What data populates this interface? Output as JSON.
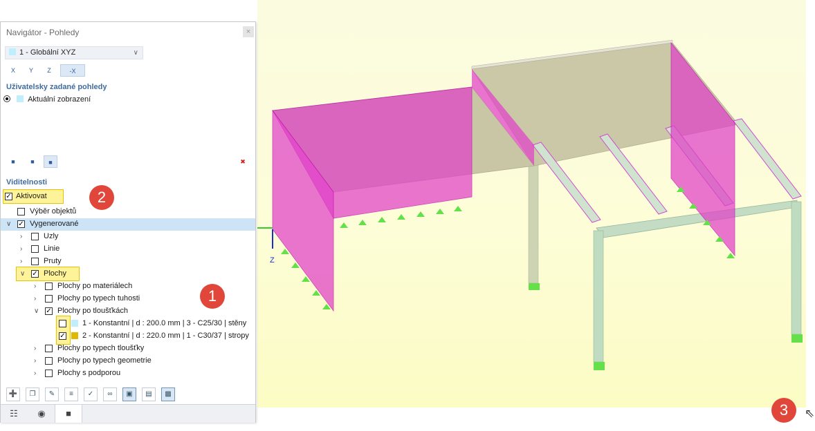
{
  "navigator": {
    "title": "Navigátor - Pohledy",
    "close_glyph": "×",
    "view_selector": {
      "value": "1 - Globální XYZ",
      "swatch_color": "#bfeefc"
    },
    "axis_buttons": [
      "X",
      "Y",
      "Z",
      "-X"
    ],
    "user_views_header": "Uživatelsky zadané pohledy",
    "current_view_label": "Aktuální zobrazení",
    "visibility_header": "Viditelnosti",
    "tree": {
      "activate": "Aktivovat",
      "object_selection": "Výběr objektů",
      "generated": "Vygenerované",
      "nodes": "Uzly",
      "lines": "Linie",
      "members": "Pruty",
      "surfaces": "Plochy",
      "by_material": "Plochy po materiálech",
      "by_stiffness": "Plochy po typech tuhosti",
      "by_thickness": "Plochy po tloušťkách",
      "thickness_1": "1 - Konstantní | d : 200.0 mm | 3 - C25/30 | stěny",
      "thickness_2": "2 - Konstantní | d : 220.0 mm | 1 - C30/37 | stropy",
      "by_thickness_type": "Plochy po typech tloušťky",
      "by_geometry": "Plochy po typech geometrie",
      "with_support": "Plochy s podporou"
    },
    "thickness_1_color": "#bfeefc",
    "thickness_2_color": "#e0b800"
  },
  "viewport": {
    "axis_label": "Z",
    "wall_color": "#e040c8",
    "slab_color": "#c8c6a8",
    "member_color": "#a9cfb0",
    "support_color": "#66e04a"
  },
  "badges": [
    "1",
    "2",
    "3"
  ]
}
